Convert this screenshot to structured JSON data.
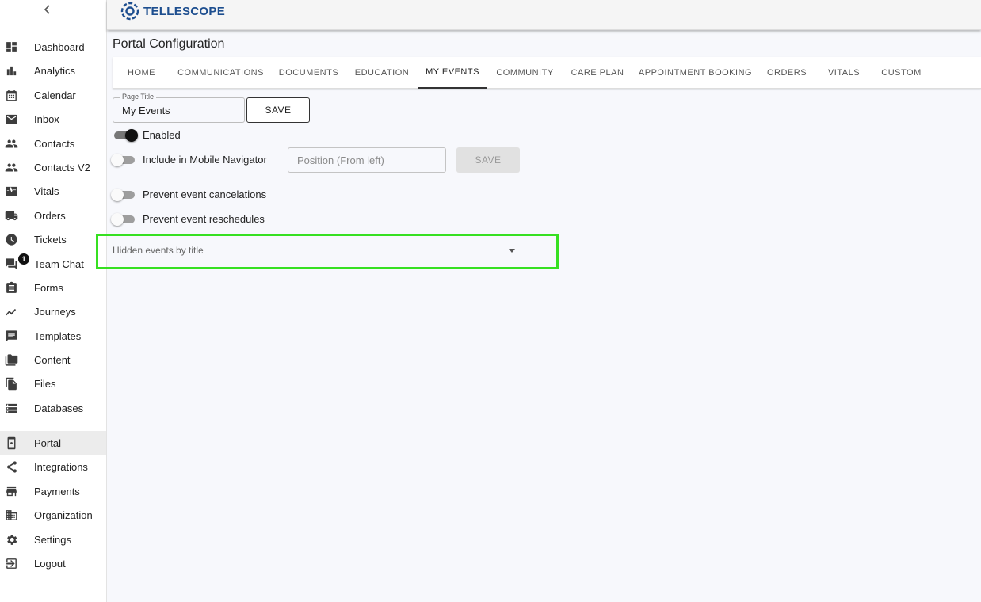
{
  "brand": {
    "name": "TELLESCOPE",
    "color": "#1d4e8f"
  },
  "sidebar": {
    "collapse_icon": "chevron-left-icon",
    "items": [
      {
        "label": "Dashboard",
        "icon": "dashboard-icon"
      },
      {
        "label": "Analytics",
        "icon": "bar-chart-icon"
      },
      {
        "label": "Calendar",
        "icon": "calendar-icon"
      },
      {
        "label": "Inbox",
        "icon": "mail-icon"
      },
      {
        "label": "Contacts",
        "icon": "people-icon"
      },
      {
        "label": "Contacts V2",
        "icon": "people-icon"
      },
      {
        "label": "Vitals",
        "icon": "monitor-heart-icon"
      },
      {
        "label": "Orders",
        "icon": "truck-icon"
      },
      {
        "label": "Tickets",
        "icon": "clock-icon"
      },
      {
        "label": "Team Chat",
        "icon": "chat-icon",
        "badge": "1"
      },
      {
        "label": "Forms",
        "icon": "clipboard-icon"
      },
      {
        "label": "Journeys",
        "icon": "timeline-icon"
      },
      {
        "label": "Templates",
        "icon": "message-icon"
      },
      {
        "label": "Content",
        "icon": "folder-icon"
      },
      {
        "label": "Files",
        "icon": "file-copy-icon"
      },
      {
        "label": "Databases",
        "icon": "storage-icon"
      },
      {
        "label": "Portal",
        "icon": "phone-settings-icon",
        "active": true
      },
      {
        "label": "Integrations",
        "icon": "share-icon"
      },
      {
        "label": "Payments",
        "icon": "store-icon"
      },
      {
        "label": "Organization",
        "icon": "building-icon"
      },
      {
        "label": "Settings",
        "icon": "gear-icon"
      },
      {
        "label": "Logout",
        "icon": "logout-icon"
      }
    ]
  },
  "main": {
    "title": "Portal Configuration",
    "tabs": [
      {
        "label": "HOME"
      },
      {
        "label": "COMMUNICATIONS"
      },
      {
        "label": "DOCUMENTS"
      },
      {
        "label": "EDUCATION"
      },
      {
        "label": "MY EVENTS",
        "active": true
      },
      {
        "label": "COMMUNITY"
      },
      {
        "label": "CARE PLAN"
      },
      {
        "label": "APPOINTMENT BOOKING"
      },
      {
        "label": "ORDERS"
      },
      {
        "label": "VITALS"
      },
      {
        "label": "CUSTOM"
      }
    ],
    "page_title_field": {
      "label": "Page Title",
      "value": "My Events"
    },
    "save_label": "SAVE",
    "enabled": {
      "label": "Enabled",
      "on": true
    },
    "mobile_navigator": {
      "label": "Include in Mobile Navigator",
      "on": false
    },
    "position_field": {
      "placeholder": "Position (From left)"
    },
    "position_save_label": "SAVE",
    "prevent_cancelations": {
      "label": "Prevent event cancelations",
      "on": false
    },
    "prevent_reschedules": {
      "label": "Prevent event reschedules",
      "on": false
    },
    "hidden_events": {
      "placeholder": "Hidden events by title"
    },
    "highlight_color": "#36e021"
  }
}
